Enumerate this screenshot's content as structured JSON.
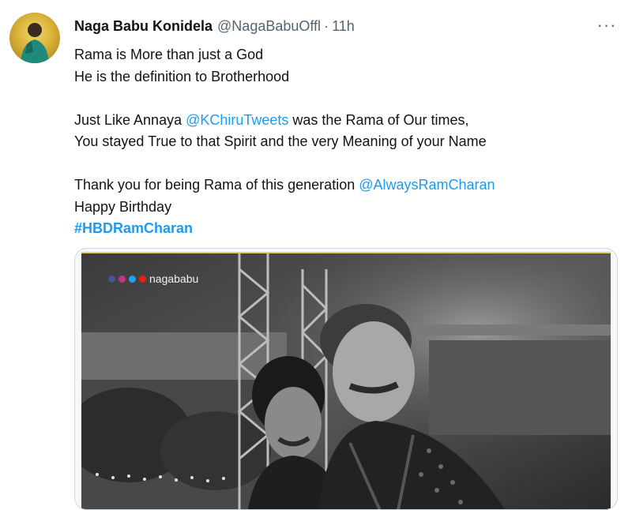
{
  "author": {
    "display_name": "Naga Babu Konidela",
    "handle": "@NagaBabuOffl",
    "separator": "·",
    "time": "11h"
  },
  "more_label": "···",
  "tweet": {
    "line1": "Rama is More than just a God",
    "line2": "He is the definition to Brotherhood",
    "line3_pre": "Just Like Annaya ",
    "line3_mention": "@KChiruTweets",
    "line3_post": " was the Rama of Our times,",
    "line4": "You stayed True to that Spirit and the very Meaning of your Name",
    "line5_pre": "Thank you for being Rama of this generation ",
    "line5_mention": "@AlwaysRamCharan",
    "line6": "Happy Birthday",
    "hashtag": "#HBDRamCharan"
  },
  "media": {
    "watermark": "nagababu",
    "social_icons": [
      "facebook-icon",
      "instagram-icon",
      "twitter-icon",
      "youtube-icon"
    ]
  },
  "colors": {
    "link": "#1d9bf0",
    "secondary_text": "#536471",
    "primary_text": "#0f1419",
    "media_border_accent": "#e8d35a"
  }
}
